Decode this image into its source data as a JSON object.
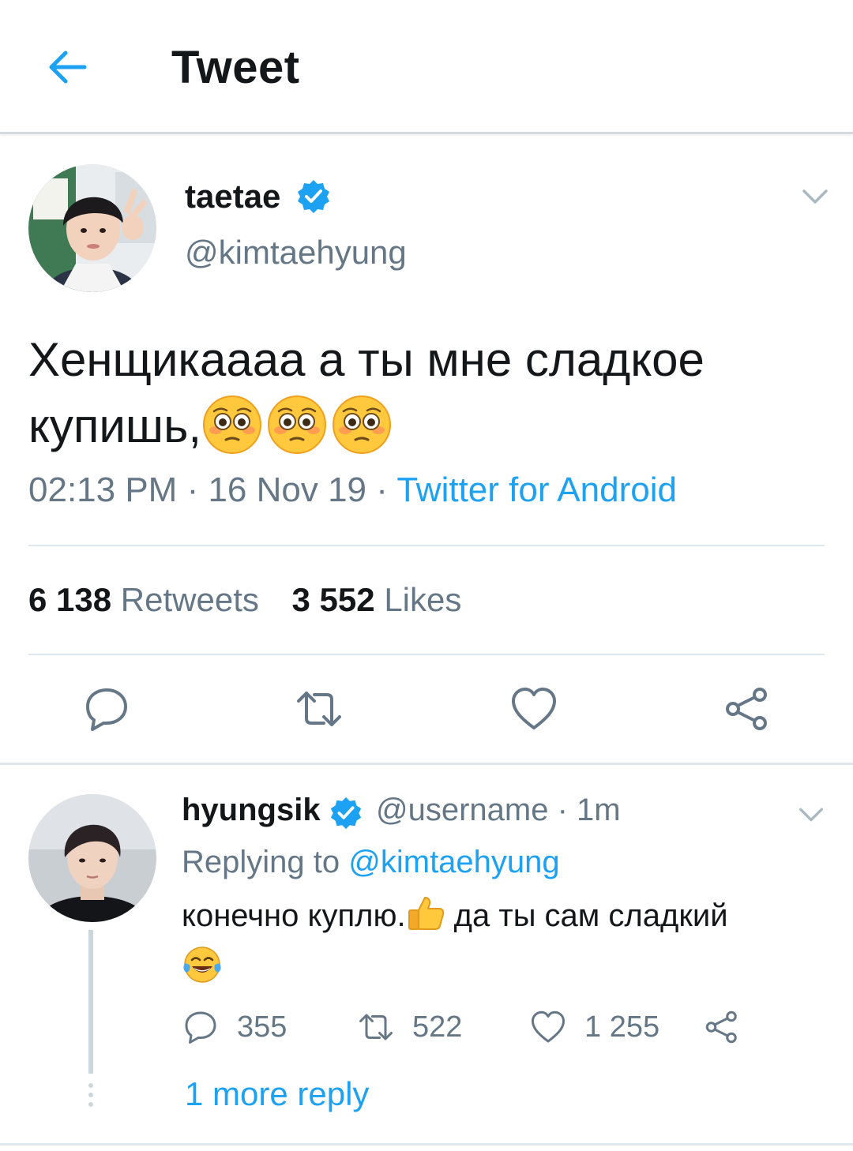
{
  "header": {
    "title": "Tweet",
    "back_icon": "arrow-left-icon",
    "accent": "#1da1f2"
  },
  "tweet": {
    "author_name": "taetae",
    "author_handle": "@kimtaehyung",
    "verified": true,
    "text_line1": "Хенщикаааа а ты мне сладкое",
    "text_line2": "купишь,",
    "emojis": [
      "flushed-pleading-face",
      "flushed-pleading-face",
      "flushed-pleading-face"
    ],
    "time": "02:13 PM",
    "date": "16 Nov 19",
    "separator": " · ",
    "source": "Twitter for Android",
    "retweets_count": "6 138",
    "retweets_label": "Retweets",
    "likes_count": "3 552",
    "likes_label": "Likes",
    "actions": [
      "reply-icon",
      "retweet-icon",
      "like-icon",
      "share-icon"
    ]
  },
  "reply": {
    "author_name": "hyungsik",
    "author_handle": "@username",
    "time": "1m",
    "meta_separator": " · ",
    "verified": true,
    "replying_prefix": "Replying to",
    "replying_to": "@kimtaehyung",
    "text_part1": "конечно куплю.",
    "text_part2": " да ты сам сладкий",
    "emojis": [
      "thumbs-up",
      "tears-of-joy"
    ],
    "reply_count": "355",
    "retweet_count": "522",
    "like_count": "1 255",
    "more_replies": "1 more reply"
  },
  "colors": {
    "text": "#14171a",
    "secondary": "#657786",
    "link": "#1da1f2",
    "divider": "#e1e8ed"
  }
}
